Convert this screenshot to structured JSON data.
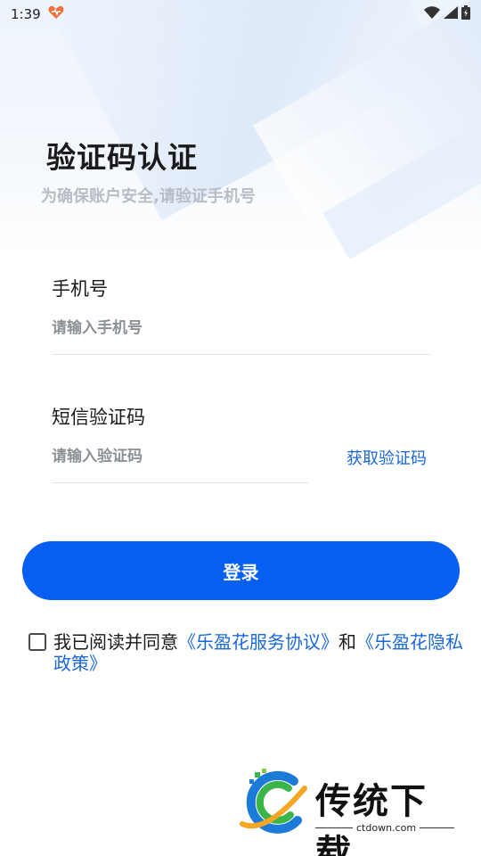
{
  "status_bar": {
    "time": "1:39"
  },
  "header": {
    "title": "验证码认证",
    "subtitle": "为确保账户安全,请验证手机号"
  },
  "phone": {
    "label": "手机号",
    "placeholder": "请输入手机号",
    "value": ""
  },
  "sms": {
    "label": "短信验证码",
    "placeholder": "请输入验证码",
    "value": "",
    "get_code_label": "获取验证码"
  },
  "login_button": {
    "label": "登录"
  },
  "agreement": {
    "checked": false,
    "prefix": "我已阅读并同意",
    "service_link": "《乐盈花服务协议》",
    "and": "和",
    "privacy_link": "《乐盈花隐私政策》"
  },
  "watermark": {
    "brand": "传统下载",
    "site": "ctdown.com"
  },
  "colors": {
    "accent": "#055ff0",
    "link": "#1a68d8",
    "placeholder": "#8c9097",
    "subtitle": "#b8bcc4"
  }
}
